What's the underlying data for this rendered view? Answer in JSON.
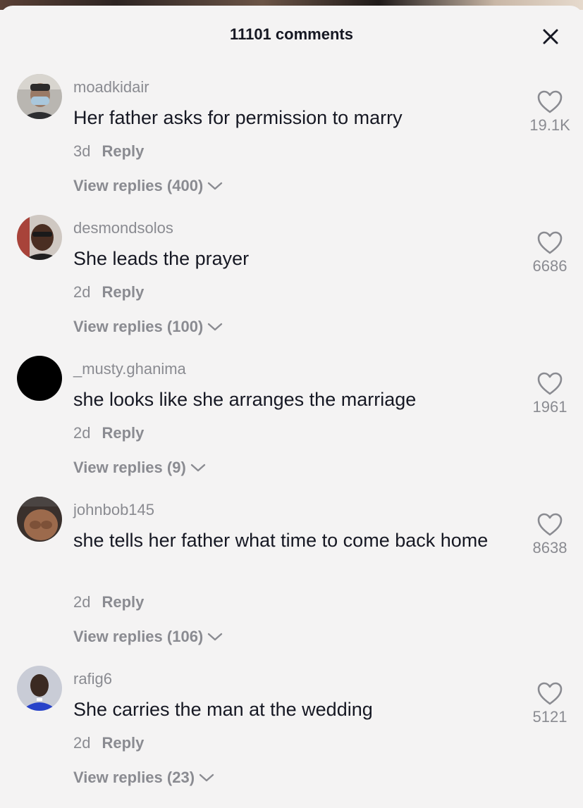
{
  "header": {
    "title": "11101 comments"
  },
  "comments": [
    {
      "username": "moadkidair",
      "text": "Her father asks for permission to marry",
      "time": "3d",
      "reply_label": "Reply",
      "view_replies": "View replies (400)",
      "likes": "19.1K"
    },
    {
      "username": "desmondsolos",
      "text": "She leads the prayer",
      "time": "2d",
      "reply_label": "Reply",
      "view_replies": "View replies (100)",
      "likes": "6686"
    },
    {
      "username": "_musty.ghanima",
      "text": "she looks like she arranges the marriage",
      "time": "2d",
      "reply_label": "Reply",
      "view_replies": "View replies (9)",
      "likes": "1961"
    },
    {
      "username": "johnbob145",
      "text": "she tells her father what time to come back home",
      "time": "2d",
      "reply_label": "Reply",
      "view_replies": "View replies (106)",
      "likes": "8638"
    },
    {
      "username": "rafig6",
      "text": "She carries the man at the wedding",
      "time": "2d",
      "reply_label": "Reply",
      "view_replies": "View replies (23)",
      "likes": "5121"
    }
  ],
  "icons": {
    "close": "close-icon",
    "like": "heart-icon",
    "expand": "chevron-down-icon"
  },
  "colors": {
    "text": "#161823",
    "secondary": "#8a8b91",
    "background": "#f4f3f3"
  }
}
